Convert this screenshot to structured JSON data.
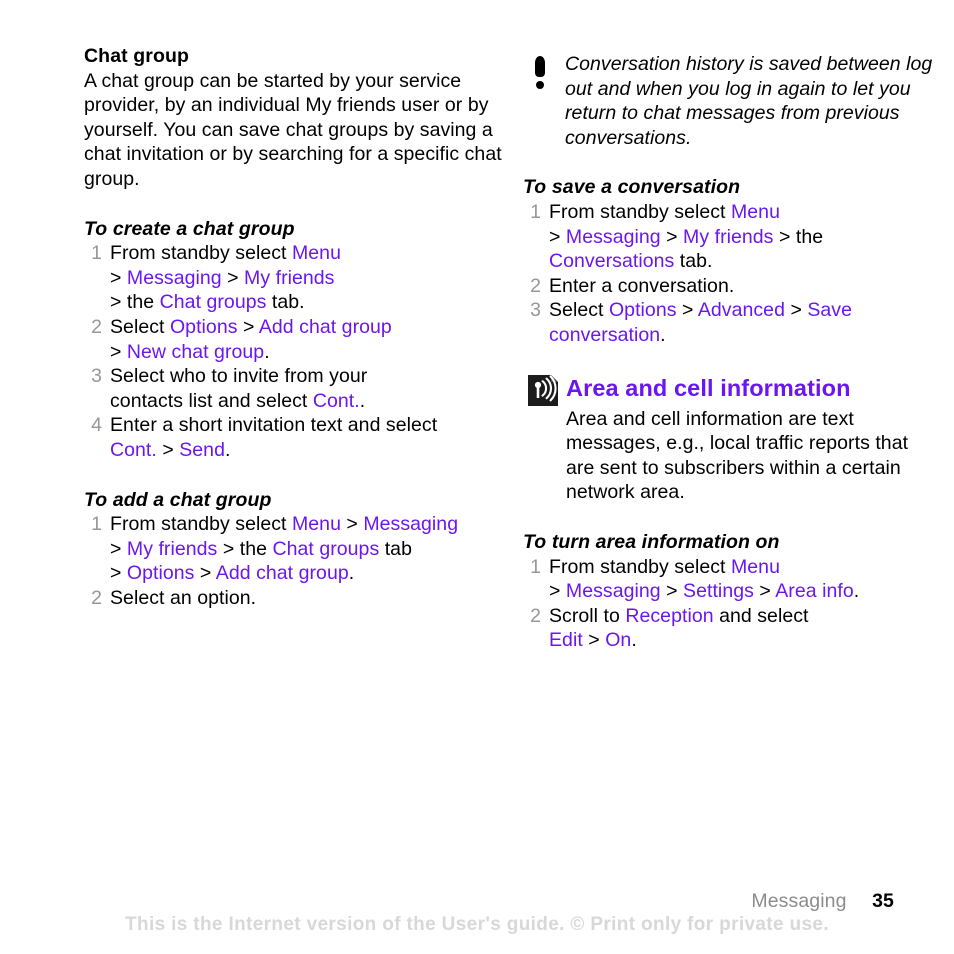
{
  "document": {
    "page_number": "35",
    "section_footer": "Messaging",
    "disclaimer": "This is the Internet version of the User's guide. © Print only for private use."
  },
  "colors": {
    "link": "#6b16f0",
    "heading": "#6b16f0",
    "step_number": "#979797",
    "footer_section": "#8c8c8c",
    "disclaimer": "#d8d8d8"
  },
  "left_column": {
    "heading": "Chat group",
    "intro": "A chat group can be started by your service provider, by an individual My friends user or by yourself. You can save chat groups by saving a chat invitation or by searching for a specific chat group.",
    "procedure_create": {
      "title": "To create a chat group",
      "steps": [
        {
          "num": "1",
          "line1_pre": "From standby select ",
          "line1_link": "Menu",
          "line2": {
            "sep1": "> ",
            "link1": "Messaging",
            "sep2": " > ",
            "link2": "My friends"
          },
          "line3": {
            "sep1": "> the ",
            "link1": "Chat groups",
            "tail": " tab."
          }
        },
        {
          "num": "2",
          "line1_pre": "Select ",
          "line1_link": "Options",
          "line1_sep": " > ",
          "line1_link2": "Add chat group",
          "line2": {
            "sep1": "> ",
            "link1": "New chat group",
            "tail": "."
          }
        },
        {
          "num": "3",
          "line1": "Select who to invite from your",
          "line2_pre": "contacts list and select ",
          "line2_link": "Cont.",
          "line2_tail": "."
        },
        {
          "num": "4",
          "line1": "Enter a short invitation text and select",
          "line2_link1": "Cont.",
          "line2_sep": " > ",
          "line2_link2": "Send",
          "line2_tail": "."
        }
      ]
    },
    "procedure_add": {
      "title": "To add a chat group",
      "steps": [
        {
          "num": "1",
          "line1_pre": "From standby select ",
          "line1_link": "Menu",
          "line1_sep": " > ",
          "line1_link2": "Messaging",
          "line2": {
            "sep1": "> ",
            "link1": "My friends",
            "sep2": " > the ",
            "link2": "Chat groups",
            "tail": " tab"
          },
          "line3": {
            "sep1": "> ",
            "link1": "Options",
            "sep2": " > ",
            "link2": "Add chat group",
            "tail": "."
          }
        },
        {
          "num": "2",
          "line1": "Select an option."
        }
      ]
    }
  },
  "right_column": {
    "note": {
      "icon": "exclamation-icon",
      "text": "Conversation history is saved between log out and when you log in again to let you return to chat messages from previous conversations."
    },
    "procedure_save": {
      "title": "To save a conversation",
      "steps": [
        {
          "num": "1",
          "line1_pre": "From standby select ",
          "line1_link": "Menu",
          "line2": {
            "sep1": "> ",
            "link1": "Messaging",
            "sep2": " > ",
            "link2": "My friends",
            "tail": " > the"
          },
          "line3": {
            "link1": "Conversations",
            "tail": " tab."
          }
        },
        {
          "num": "2",
          "line1": "Enter a conversation."
        },
        {
          "num": "3",
          "line1_pre": "Select ",
          "line1_link": "Options",
          "line1_sep": " > ",
          "line1_link2": "Advanced",
          "line1_sep2": " > ",
          "line1_link3": "Save",
          "line2_link": "conversation",
          "line2_tail": "."
        }
      ]
    },
    "section": {
      "icon": "area-cell-antenna-icon",
      "title": "Area and cell information",
      "body": "Area and cell information are text messages, e.g., local traffic reports that are sent to subscribers within a certain network area."
    },
    "procedure_area": {
      "title": "To turn area information on",
      "steps": [
        {
          "num": "1",
          "line1_pre": "From standby select ",
          "line1_link": "Menu",
          "line2": {
            "sep1": "> ",
            "link1": "Messaging",
            "sep2": " > ",
            "link2": "Settings",
            "sep3": " > ",
            "link3": "Area info",
            "tail": "."
          }
        },
        {
          "num": "2",
          "line1_pre": "Scroll to ",
          "line1_link": "Reception",
          "line1_tail": " and select",
          "line2_link1": "Edit",
          "line2_sep": " > ",
          "line2_link2": "On",
          "line2_tail": "."
        }
      ]
    }
  }
}
